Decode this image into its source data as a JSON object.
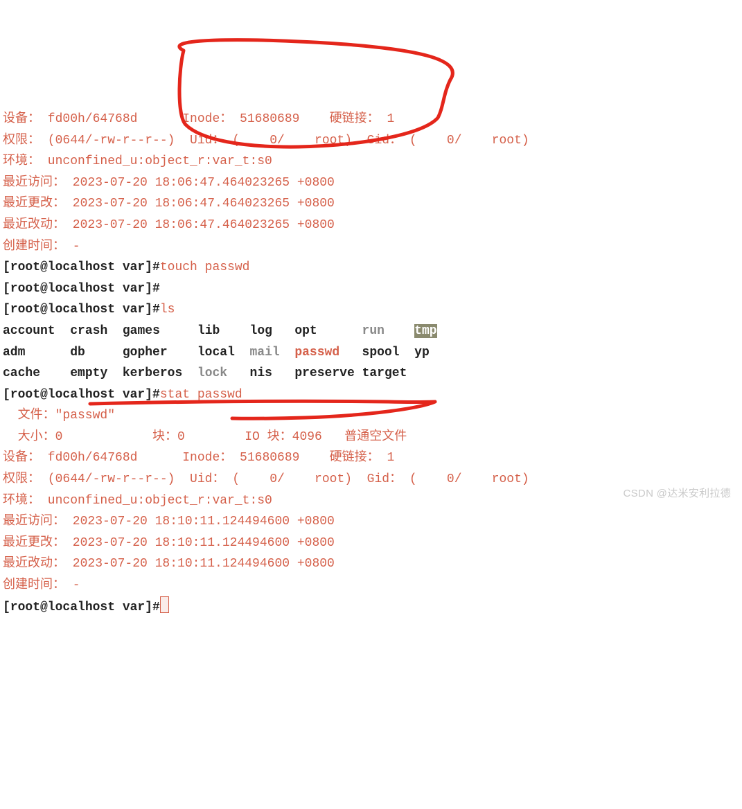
{
  "stat1": {
    "device": "设备： fd00h/64768d      Inode： 51680689    硬链接： 1",
    "perm": "权限： (0644/-rw-r--r--)  Uid： (    0/    root)  Gid： (    0/    root)",
    "env": "环境： unconfined_u:object_r:var_t:s0",
    "atime": "最近访问： 2023-07-20 18:06:47.464023265 +0800",
    "mtime": "最近更改： 2023-07-20 18:06:47.464023265 +0800",
    "ctime": "最近改动： 2023-07-20 18:06:47.464023265 +0800",
    "btime": "创建时间： -"
  },
  "prompt": {
    "full": "[root@localhost var]#",
    "cmd_touch": "touch passwd",
    "cmd_ls": "ls",
    "cmd_stat": "stat passwd"
  },
  "ls": {
    "r1": {
      "c1": "account",
      "c2": "crash",
      "c3": "games",
      "c4": "lib",
      "c5": "log",
      "c6": "opt",
      "c7": "run",
      "c8": "tmp"
    },
    "r2": {
      "c1": "adm",
      "c2": "db",
      "c3": "gopher",
      "c4": "local",
      "c5": "mail",
      "c6": "passwd",
      "c7": "spool",
      "c8": "yp"
    },
    "r3": {
      "c1": "cache",
      "c2": "empty",
      "c3": "kerberos",
      "c4": "lock",
      "c5": "nis",
      "c6": "preserve",
      "c7": "target"
    }
  },
  "stat2": {
    "file": "  文件：\"passwd\"",
    "size": "  大小：0            块：0        IO 块：4096   普通空文件",
    "device": "设备： fd00h/64768d      Inode： 51680689    硬链接： 1",
    "perm": "权限： (0644/-rw-r--r--)  Uid： (    0/    root)  Gid： (    0/    root)",
    "env": "环境： unconfined_u:object_r:var_t:s0",
    "atime": "最近访问： 2023-07-20 18:10:11.124494600 +0800",
    "mtime": "最近更改： 2023-07-20 18:10:11.124494600 +0800",
    "ctime": "最近改动： 2023-07-20 18:10:11.124494600 +0800",
    "btime": "创建时间： -"
  },
  "watermark": "CSDN @达米安利拉德"
}
